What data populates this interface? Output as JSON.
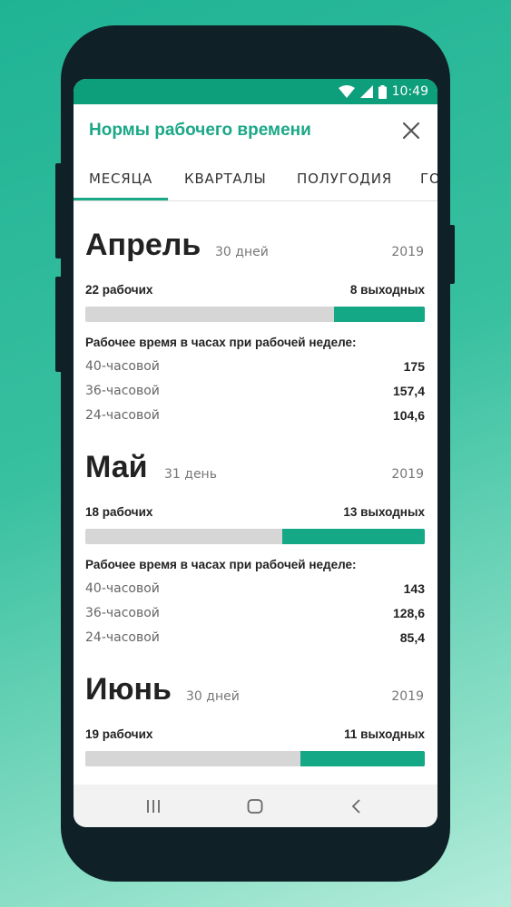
{
  "status_bar": {
    "time": "10:49",
    "icons": [
      "wifi-icon",
      "signal-icon",
      "battery-icon"
    ]
  },
  "app_bar": {
    "title": "Нормы рабочего времени",
    "close_icon": "close-icon"
  },
  "tabs": [
    {
      "label": "МЕСЯЦА",
      "active": true
    },
    {
      "label": "КВАРТАЛЫ",
      "active": false
    },
    {
      "label": "ПОЛУГОДИЯ",
      "active": false
    },
    {
      "label": "ГО",
      "active": false
    }
  ],
  "hours_title": "Рабочее время в часах при рабочей неделе:",
  "months": [
    {
      "name": "Апрель",
      "days": "30 дней",
      "year": "2019",
      "working": "22 рабочих",
      "off": "8 выходных",
      "working_count": 22,
      "off_count": 8,
      "rows": [
        {
          "label": "40-часовой",
          "value": "175"
        },
        {
          "label": "36-часовой",
          "value": "157,4"
        },
        {
          "label": "24-часовой",
          "value": "104,6"
        }
      ]
    },
    {
      "name": "Май",
      "days": "31 день",
      "year": "2019",
      "working": "18 рабочих",
      "off": "13 выходных",
      "working_count": 18,
      "off_count": 13,
      "rows": [
        {
          "label": "40-часовой",
          "value": "143"
        },
        {
          "label": "36-часовой",
          "value": "128,6"
        },
        {
          "label": "24-часовой",
          "value": "85,4"
        }
      ]
    },
    {
      "name": "Июнь",
      "days": "30 дней",
      "year": "2019",
      "working": "19 рабочих",
      "off": "11 выходных",
      "working_count": 19,
      "off_count": 11,
      "rows": []
    }
  ],
  "nav_bar": [
    "recent-apps-icon",
    "home-icon",
    "back-icon"
  ],
  "colors": {
    "accent": "#1ba887",
    "status_bar": "#0d9e7c",
    "bar_track": "#d6d6d6",
    "bar_fill": "#14a886"
  }
}
